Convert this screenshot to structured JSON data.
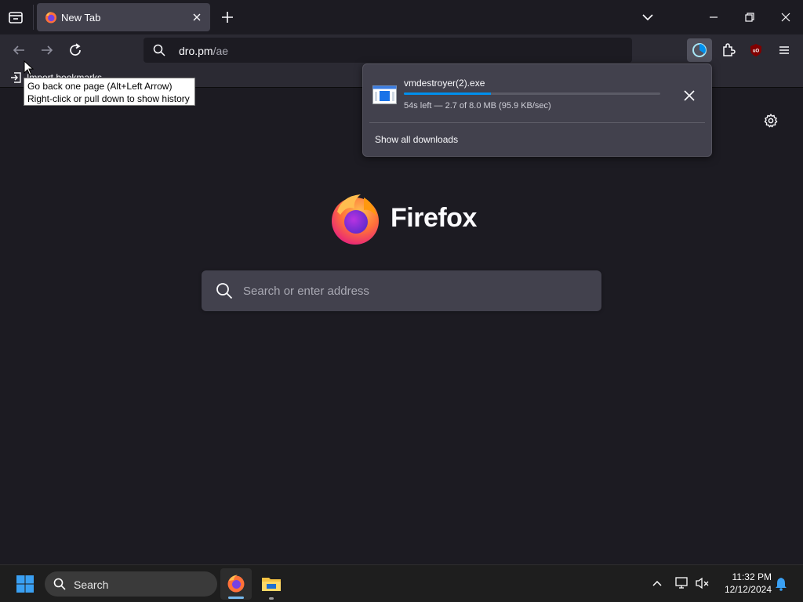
{
  "tab": {
    "title": "New Tab",
    "favicon": "firefox-icon"
  },
  "navbar": {
    "url_host": "dro.pm",
    "url_path": "/ae"
  },
  "bookmarks": {
    "import_label": "Import bookmarks"
  },
  "tooltip": {
    "line1": "Go back one page (Alt+Left Arrow)",
    "line2": "Right-click or pull down to show history"
  },
  "downloads": {
    "filename": "vmdestroyer(2).exe",
    "status": "54s left — 2.7 of 8.0 MB (95.9 KB/sec)",
    "progress_fraction": 0.34,
    "show_all_label": "Show all downloads"
  },
  "newtab": {
    "wordmark": "Firefox",
    "search_placeholder": "Search or enter address"
  },
  "taskbar": {
    "search_label": "Search",
    "time": "11:32 PM",
    "date": "12/12/2024"
  },
  "colors": {
    "accent_progress": "#0090ed",
    "background": "#1c1b22",
    "toolbar": "#2b2a33",
    "panel": "#42414d"
  }
}
